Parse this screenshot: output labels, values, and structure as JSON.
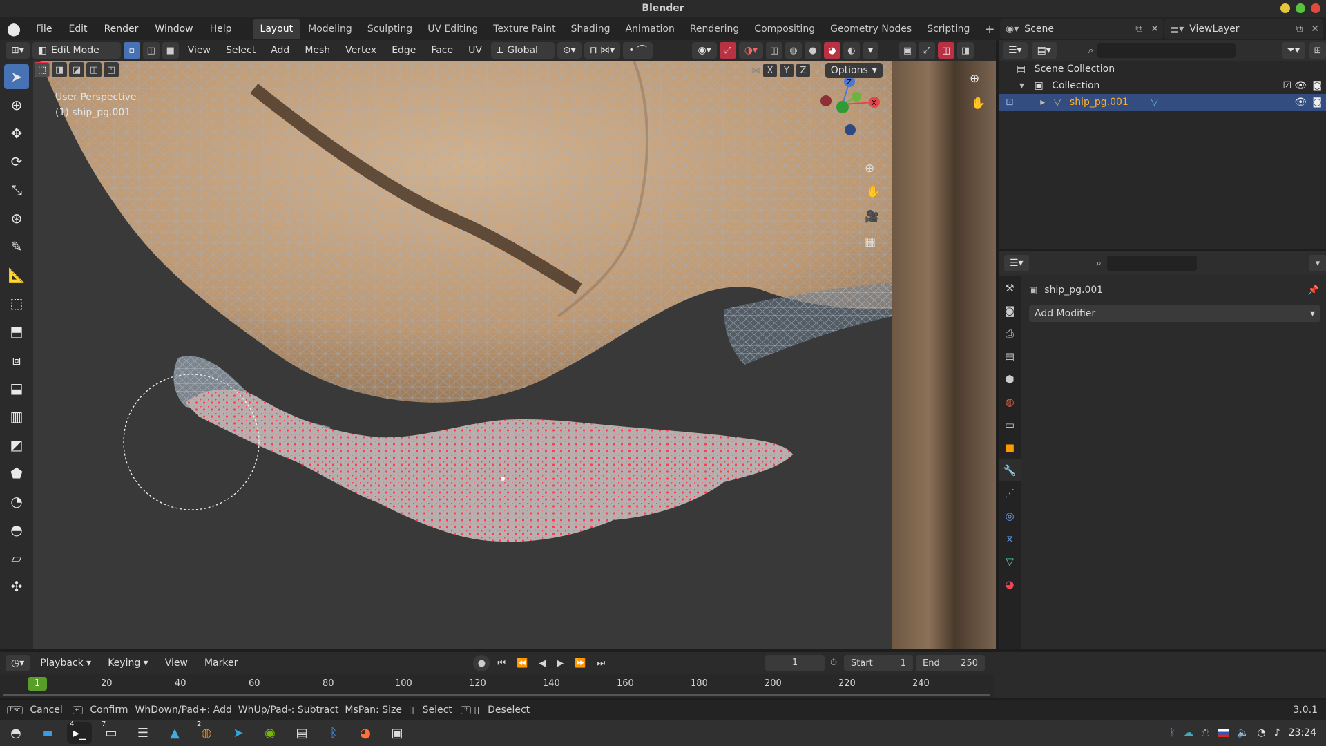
{
  "window": {
    "title": "Blender"
  },
  "menu": [
    "File",
    "Edit",
    "Render",
    "Window",
    "Help"
  ],
  "workspaces": [
    "Layout",
    "Modeling",
    "Sculpting",
    "UV Editing",
    "Texture Paint",
    "Shading",
    "Animation",
    "Rendering",
    "Compositing",
    "Geometry Nodes",
    "Scripting"
  ],
  "active_workspace": "Layout",
  "scene": {
    "name": "Scene",
    "view_layer": "ViewLayer"
  },
  "viewport_header": {
    "mode": "Edit Mode",
    "menus": [
      "View",
      "Select",
      "Add",
      "Mesh",
      "Vertex",
      "Edge",
      "Face",
      "UV"
    ],
    "orientation": "Global",
    "options": "Options",
    "axes": [
      "X",
      "Y",
      "Z"
    ]
  },
  "viewport": {
    "perspective": "User Perspective",
    "object": "(1) ship_pg.001"
  },
  "outliner": {
    "rows": [
      {
        "label": "Scene Collection"
      },
      {
        "label": "Collection"
      },
      {
        "label": "ship_pg.001"
      }
    ]
  },
  "properties": {
    "object_name": "ship_pg.001",
    "add_modifier": "Add Modifier"
  },
  "timeline": {
    "menus": [
      "Playback",
      "Keying",
      "View",
      "Marker"
    ],
    "current_frame": "1",
    "start_label": "Start",
    "start": "1",
    "end_label": "End",
    "end": "250",
    "ticks": [
      "1",
      "20",
      "40",
      "60",
      "80",
      "100",
      "120",
      "140",
      "160",
      "180",
      "200",
      "220",
      "240"
    ]
  },
  "statusbar": {
    "cancel": "Cancel",
    "confirm": "Confirm",
    "hint": "WhDown/Pad+: Add  WhUp/Pad-: Subtract  MsPan: Size",
    "select": "Select",
    "deselect": "Deselect",
    "version": "3.0.1"
  },
  "taskbar": {
    "badges": [
      "4",
      "7",
      "2"
    ],
    "clock": "23:24"
  },
  "colors": {
    "accent": "#4772b3",
    "selected_vertex": "#ff3b4f",
    "active_object": "#ffaf29"
  }
}
